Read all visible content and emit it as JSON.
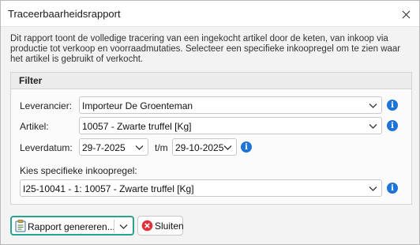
{
  "window": {
    "title": "Traceerbaarheidsrapport"
  },
  "description": "Dit rapport toont de volledige tracering van een ingekocht artikel door de keten, van inkoop via productie tot verkoop en voorraadmutaties. Selecteer een specifieke inkoopregel om te zien waar het artikel is gebruikt of verkocht.",
  "filter": {
    "title": "Filter",
    "supplier": {
      "label": "Leverancier:",
      "value": "Importeur De Groenteman"
    },
    "article": {
      "label": "Artikel:",
      "value": "10057 - Zwarte truffel  [Kg]"
    },
    "delivery_date": {
      "label": "Leverdatum:",
      "from": "29-7-2025",
      "separator": "t/m",
      "to": "29-10-2025"
    },
    "purchase_line": {
      "label": "Kies specifieke inkoopregel:",
      "value": "I25-10041 - 1: 10057 - Zwarte truffel [Kg]"
    }
  },
  "buttons": {
    "generate_label": "Rapport genereren...",
    "close_label": "Sluiten"
  },
  "colors": {
    "accent": "#2aa28f",
    "info": "#1e73d6",
    "close_icon": "#e0313b"
  },
  "icons": {
    "window_close": "close-icon",
    "info": "info-icon",
    "dropdown": "chevron-down-icon",
    "report": "clipboard-report-icon",
    "cancel": "cancel-circle-icon"
  }
}
